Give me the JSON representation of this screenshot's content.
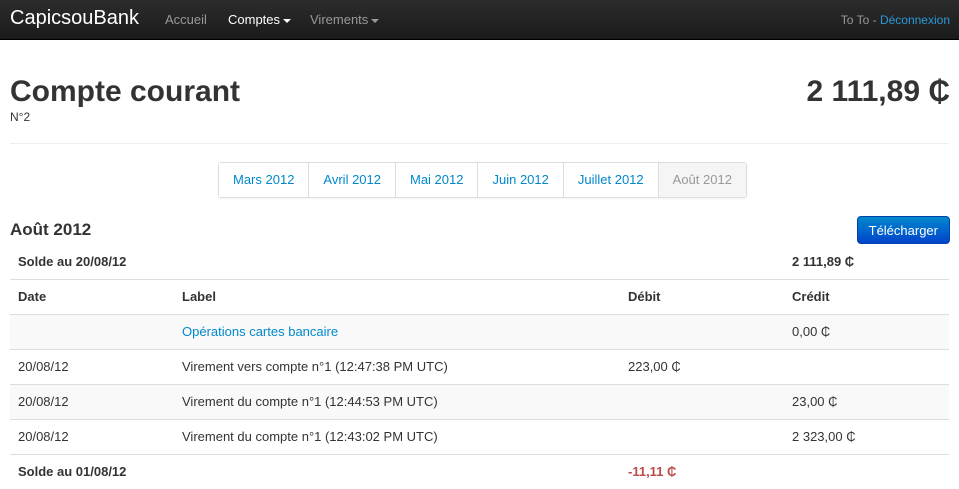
{
  "nav": {
    "brand": "CapicsouBank",
    "items": [
      {
        "label": "Accueil"
      },
      {
        "label": "Comptes"
      },
      {
        "label": "Virements"
      }
    ],
    "user": "To To",
    "separator": " - ",
    "logout": "Déconnexion"
  },
  "account": {
    "title": "Compte courant",
    "number": "N°2",
    "balance": "2 111,89 ₵"
  },
  "months": [
    "Mars 2012",
    "Avril 2012",
    "Mai 2012",
    "Juin 2012",
    "Juillet 2012",
    "Août 2012"
  ],
  "current_month": "Août 2012",
  "download_label": "Télécharger",
  "table": {
    "opening": {
      "label": "Solde au 20/08/12",
      "value": "2 111,89 ₵"
    },
    "headers": {
      "date": "Date",
      "label": "Label",
      "debit": "Débit",
      "credit": "Crédit"
    },
    "rows": [
      {
        "date": "",
        "label": "Opérations cartes bancaire",
        "debit": "",
        "credit": "0,00 ₵"
      },
      {
        "date": "20/08/12",
        "label": "Virement vers compte n°1 (12:47:38 PM UTC)",
        "debit": "223,00 ₵",
        "credit": ""
      },
      {
        "date": "20/08/12",
        "label": "Virement du compte n°1 (12:44:53 PM UTC)",
        "debit": "",
        "credit": "23,00 ₵"
      },
      {
        "date": "20/08/12",
        "label": "Virement du compte n°1 (12:43:02 PM UTC)",
        "debit": "",
        "credit": "2 323,00 ₵"
      }
    ],
    "closing": {
      "label": "Solde au 01/08/12",
      "debit": "-11,11 ₵"
    }
  },
  "colors": {
    "link": "#0088cc",
    "negative": "#b94a48",
    "navbar": "#1b1b1b"
  }
}
